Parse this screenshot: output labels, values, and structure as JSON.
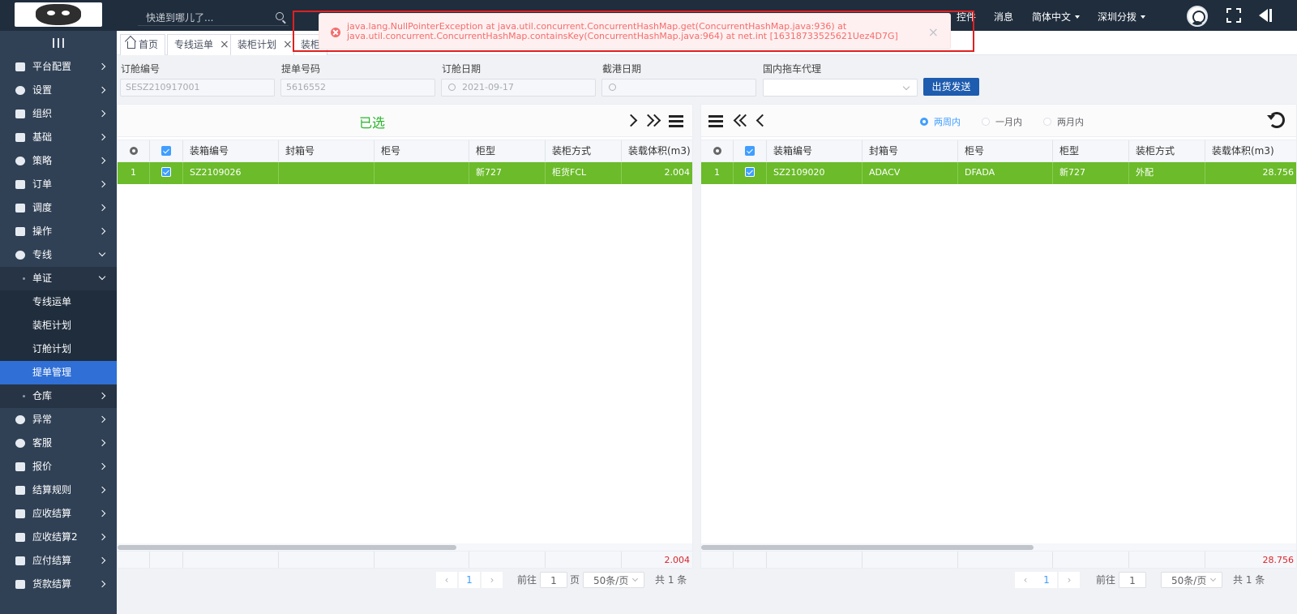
{
  "header": {
    "search_placeholder": "快递到哪儿了...",
    "controls_label": "控件",
    "messages_label": "消息",
    "language_label": "简体中文",
    "branch_label": "深圳分拨"
  },
  "sidebar": {
    "items": [
      {
        "label": "平台配置",
        "icon": "monitor-icon"
      },
      {
        "label": "设置",
        "icon": "gear-icon"
      },
      {
        "label": "组织",
        "icon": "people-icon"
      },
      {
        "label": "基础",
        "icon": "layers-icon"
      },
      {
        "label": "策略",
        "icon": "strategy-icon"
      },
      {
        "label": "订单",
        "icon": "order-icon"
      },
      {
        "label": "调度",
        "icon": "dispatch-icon"
      },
      {
        "label": "操作",
        "icon": "hand-icon"
      },
      {
        "label": "专线",
        "icon": "line-icon"
      },
      {
        "label": "单证",
        "icon": "doc-icon"
      },
      {
        "label": "专线运单"
      },
      {
        "label": "装柜计划"
      },
      {
        "label": "订舱计划"
      },
      {
        "label": "提单管理"
      },
      {
        "label": "仓库",
        "icon": "warehouse-icon"
      },
      {
        "label": "异常",
        "icon": "alert-icon"
      },
      {
        "label": "客服",
        "icon": "headset-icon"
      },
      {
        "label": "报价",
        "icon": "quote-icon"
      },
      {
        "label": "结算规则",
        "icon": "rules-icon"
      },
      {
        "label": "应收结算",
        "icon": "receivable-icon"
      },
      {
        "label": "应收结算2",
        "icon": "receivable-icon"
      },
      {
        "label": "应付结算",
        "icon": "payable-icon"
      },
      {
        "label": "货款结算",
        "icon": "payment-icon"
      }
    ]
  },
  "tabs": [
    {
      "label": "首页"
    },
    {
      "label": "专线运单"
    },
    {
      "label": "装柜计划"
    },
    {
      "label": "装柜"
    }
  ],
  "form": {
    "booking_no_label": "订舱编号",
    "booking_no_value": "SESZ210917001",
    "bl_no_label": "提单号码",
    "bl_no_value": "5616552",
    "booking_date_label": "订舱日期",
    "booking_date_value": "2021-09-17",
    "cutoff_date_label": "截港日期",
    "cutoff_date_value": "",
    "truck_agent_label": "国内拖车代理",
    "ship_button": "出货发送"
  },
  "left_panel": {
    "title": "已选",
    "columns": [
      "装箱编号",
      "封箱号",
      "柜号",
      "柜型",
      "装柜方式",
      "装载体积(m3)"
    ],
    "rows": [
      {
        "index": "1",
        "box_no": "SZ2109026",
        "seal_no": "",
        "container_no": "",
        "container_type": "新727",
        "load_method": "柜货FCL",
        "volume": "2.004"
      }
    ],
    "total_volume": "2.004"
  },
  "right_panel": {
    "filters": [
      "两周内",
      "一月内",
      "两月内"
    ],
    "selected_filter": "两周内",
    "columns": [
      "装箱编号",
      "封箱号",
      "柜号",
      "柜型",
      "装柜方式",
      "装载体积(m3)"
    ],
    "rows": [
      {
        "index": "1",
        "box_no": "SZ2109020",
        "seal_no": "ADACV",
        "container_no": "DFADA",
        "container_type": "新727",
        "load_method": "外配",
        "volume": "28.756"
      }
    ],
    "total_volume": "28.756"
  },
  "pagination": {
    "goto_label": "前往",
    "page_value": "1",
    "page_unit": "页",
    "page_size": "50条/页",
    "total": "共 1 条",
    "current_page": "1"
  },
  "error_toast": {
    "message": "java.lang.NullPointerException at java.util.concurrent.ConcurrentHashMap.get(ConcurrentHashMap.java:936) at java.util.concurrent.ConcurrentHashMap.containsKey(ConcurrentHashMap.java:964) at net.int [16318733525621Uez4D7G]"
  }
}
